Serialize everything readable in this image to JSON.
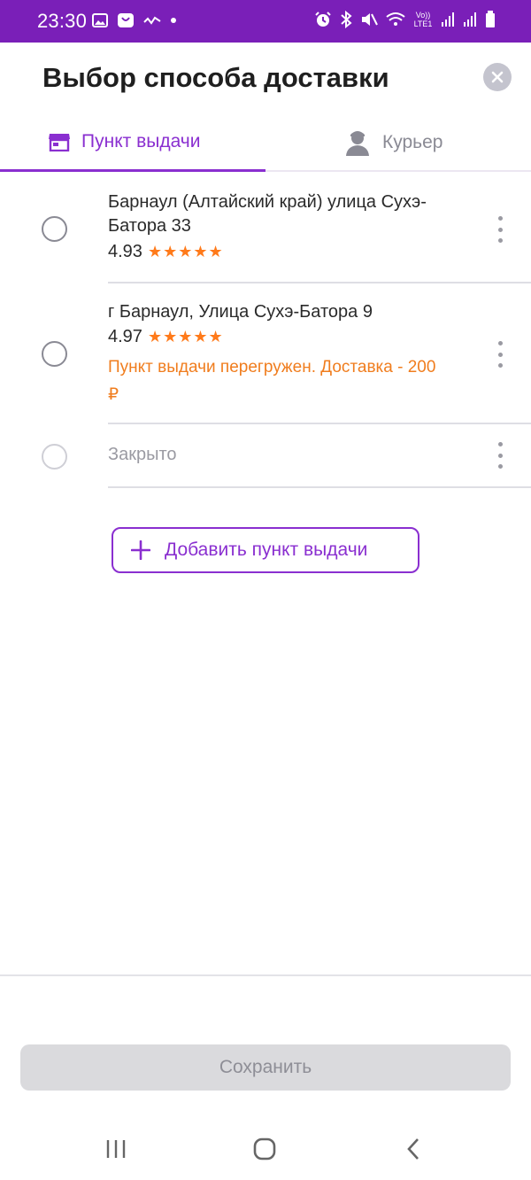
{
  "status_bar": {
    "time": "23:30",
    "left_icons": [
      "image-icon",
      "shopping-bag-icon",
      "activity-icon",
      "dot-icon"
    ],
    "right_icons": [
      "alarm-icon",
      "bluetooth-icon",
      "mute-icon",
      "wifi-icon",
      "volte-icon",
      "signal-icon",
      "signal-icon",
      "battery-icon"
    ],
    "volte_label": "Vo))\nLTE1"
  },
  "header": {
    "title": "Выбор способа доставки",
    "close_icon": "close-icon"
  },
  "tabs": [
    {
      "label": "Пункт выдачи",
      "icon": "store-icon",
      "active": true
    },
    {
      "label": "Курьер",
      "icon": "courier-icon",
      "active": false
    }
  ],
  "pickup_points": [
    {
      "address": "Барнаул (Алтайский край) улица Сухэ-Батора 33",
      "rating": "4.93",
      "stars": "★★★★★",
      "warning": "",
      "disabled": false
    },
    {
      "address": "г Барнаул, Улица Сухэ-Батора 9",
      "rating": "4.97",
      "stars": "★★★★★",
      "warning": "Пункт выдачи перегружен. Доставка - 200 ₽",
      "disabled": false
    },
    {
      "address": "Закрыто",
      "rating": "",
      "stars": "",
      "warning": "",
      "disabled": true
    }
  ],
  "add_button": {
    "label": "Добавить пункт выдачи",
    "icon": "plus-icon"
  },
  "save_button": {
    "label": "Сохранить",
    "enabled": false
  },
  "colors": {
    "status_bar": "#7a1fb8",
    "accent": "#8a2fd0",
    "star": "#ff7a1a",
    "warning": "#f07d1e",
    "disabled_button": "#dadadd"
  },
  "nav_bar": [
    "recent-apps-icon",
    "home-icon",
    "back-icon"
  ]
}
